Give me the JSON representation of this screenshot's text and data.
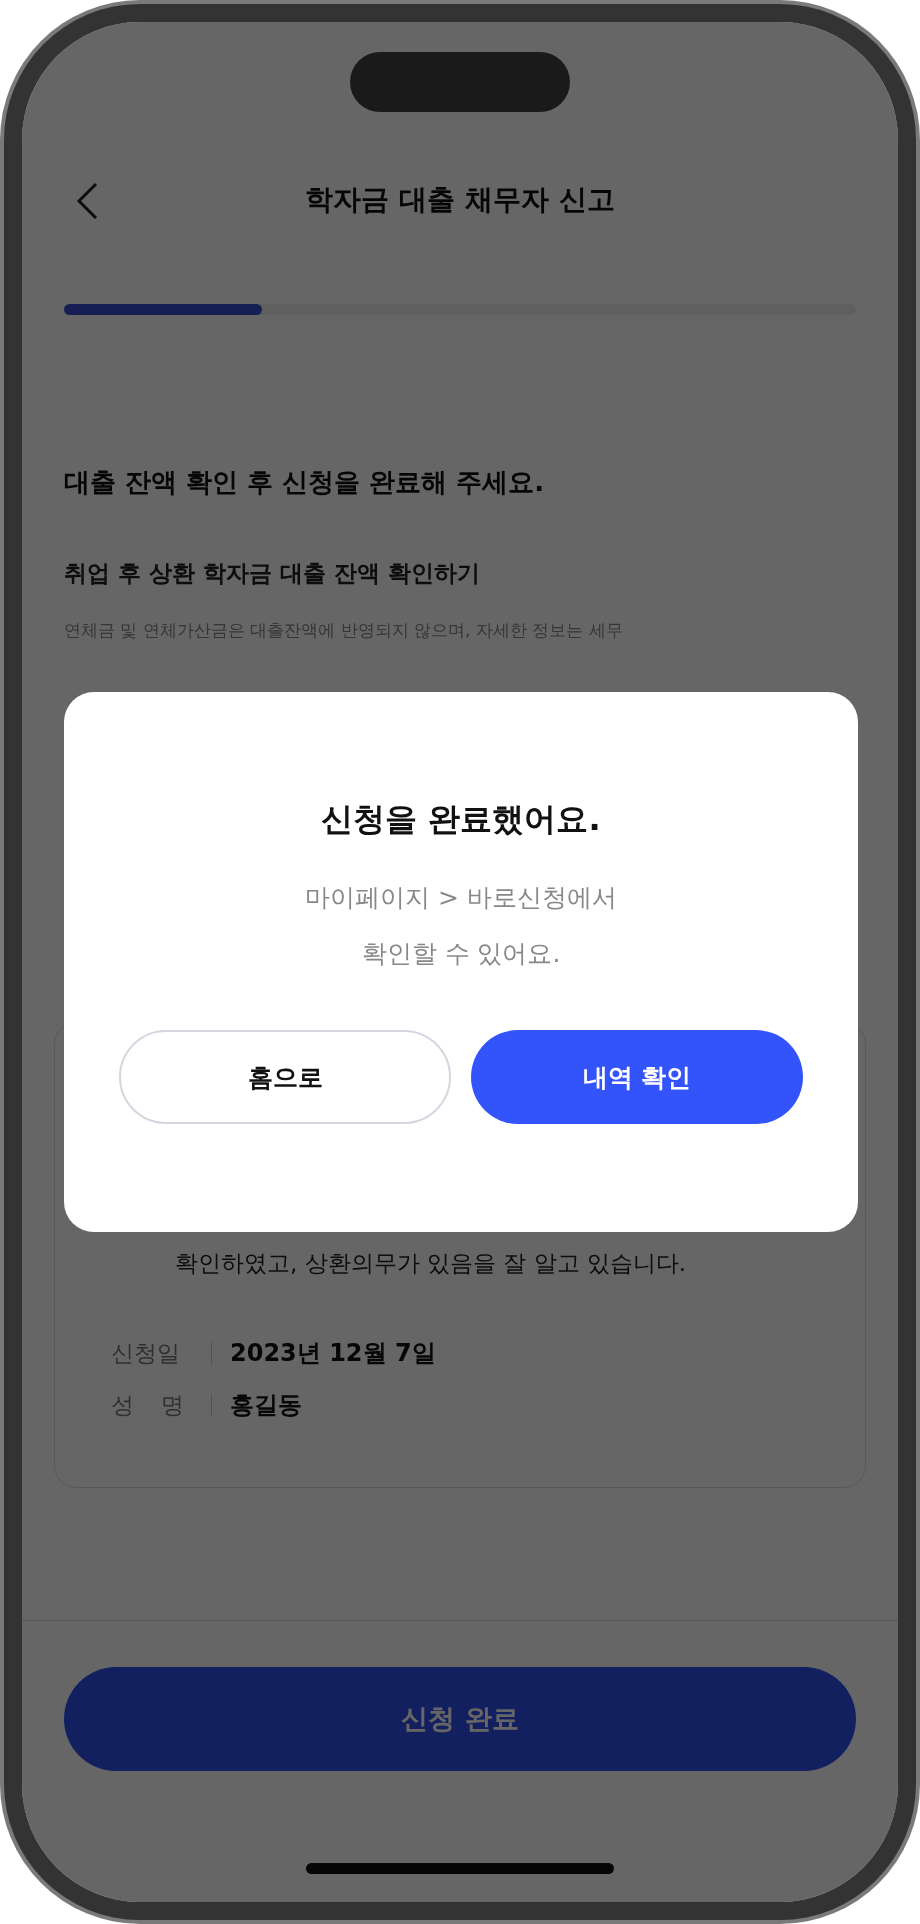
{
  "header": {
    "title": "학자금 대출 채무자 신고"
  },
  "progress": {
    "level": 0.25
  },
  "heading": "대출 잔액 확인 후 신청을 완료해 주세요.",
  "section": {
    "title": "취업 후 상환 학자금 대출 잔액 확인하기",
    "description": "연체금 및 연체가산금은 대출잔액에 반영되지 않으며, 자세한 정보는 세무"
  },
  "card": {
    "statement": "확인하였고, 상환의무가 있음을 잘 알고 있습니다.",
    "fields": [
      {
        "label": "신청일",
        "value": "2023년 12월 7일"
      },
      {
        "label": "성 명",
        "value": "홍길동"
      }
    ]
  },
  "submit_button": "신청 완료",
  "dialog": {
    "title": "신청을 완료했어요.",
    "message_lines": [
      "마이페이지 > 바로신청에서",
      "확인할 수 있어요."
    ],
    "buttons": [
      {
        "label": "홈으로",
        "kind": "secondary"
      },
      {
        "label": "내역 확인",
        "kind": "primary"
      }
    ]
  }
}
